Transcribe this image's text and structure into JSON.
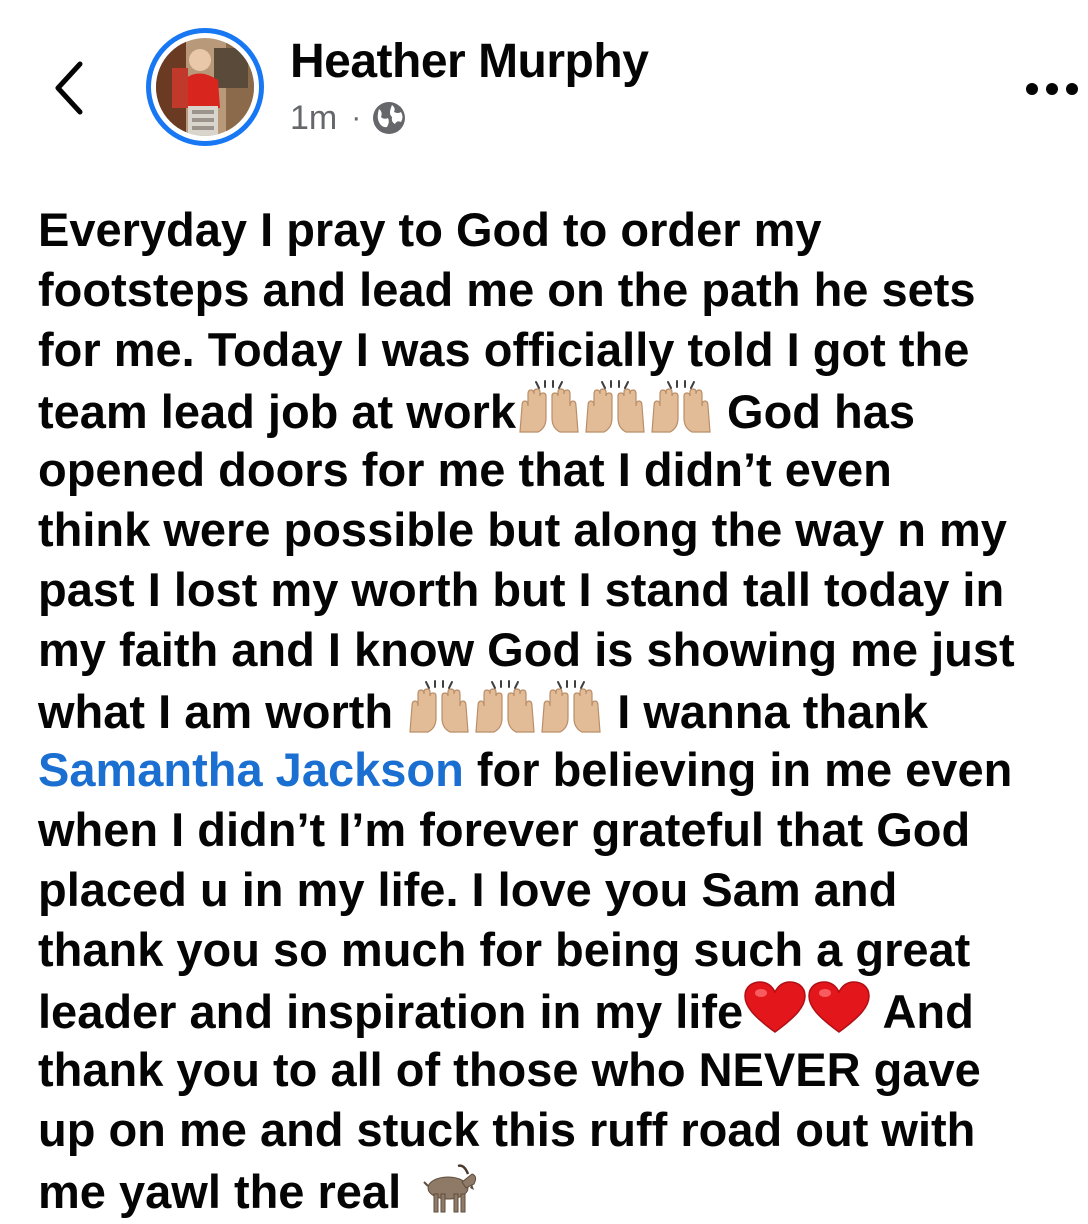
{
  "header": {
    "author_name": "Heather Murphy",
    "timestamp": "1m",
    "separator": "·",
    "privacy_icon": "globe-icon",
    "back_icon": "chevron-left-icon",
    "more_icon": "more-horizontal-icon"
  },
  "post": {
    "lines": [
      [
        {
          "t": "text",
          "v": "Everyday I pray to God to order my"
        }
      ],
      [
        {
          "t": "text",
          "v": "footsteps and lead me on the path he sets"
        }
      ],
      [
        {
          "t": "text",
          "v": "for me. Today I was officially told I got the"
        }
      ],
      [
        {
          "t": "text",
          "v": "team lead job at work"
        },
        {
          "t": "emoji",
          "v": "raising-hands"
        },
        {
          "t": "emoji",
          "v": "raising-hands"
        },
        {
          "t": "emoji",
          "v": "raising-hands"
        },
        {
          "t": "text",
          "v": " God has"
        }
      ],
      [
        {
          "t": "text",
          "v": "opened doors for me that I didn’t even"
        }
      ],
      [
        {
          "t": "text",
          "v": "think were possible but along the way n my"
        }
      ],
      [
        {
          "t": "text",
          "v": "past I lost my worth but I stand tall today in"
        }
      ],
      [
        {
          "t": "text",
          "v": "my faith and I know God is showing me just"
        }
      ],
      [
        {
          "t": "text",
          "v": "what I am worth "
        },
        {
          "t": "emoji",
          "v": "raising-hands"
        },
        {
          "t": "emoji",
          "v": "raising-hands"
        },
        {
          "t": "emoji",
          "v": "raising-hands"
        },
        {
          "t": "text",
          "v": " I wanna thank"
        }
      ],
      [
        {
          "t": "mention",
          "v": "Samantha Jackson"
        },
        {
          "t": "text",
          "v": " for believing in me even"
        }
      ],
      [
        {
          "t": "text",
          "v": "when I didn’t I’m forever grateful that God"
        }
      ],
      [
        {
          "t": "text",
          "v": "placed u in my life. I love you Sam and"
        }
      ],
      [
        {
          "t": "text",
          "v": "thank you so much for being such a great"
        }
      ],
      [
        {
          "t": "text",
          "v": "leader and inspiration in my life"
        },
        {
          "t": "emoji",
          "v": "red-heart"
        },
        {
          "t": "emoji",
          "v": "red-heart"
        },
        {
          "t": "text",
          "v": " And"
        }
      ],
      [
        {
          "t": "text",
          "v": "thank you to all of those who NEVER gave"
        }
      ],
      [
        {
          "t": "text",
          "v": "up on me and stuck this ruff road out with"
        }
      ],
      [
        {
          "t": "text",
          "v": "me yawl the real "
        },
        {
          "t": "emoji",
          "v": "goat"
        }
      ]
    ]
  },
  "colors": {
    "accent": "#1877f2",
    "mention": "#1a6fd1",
    "text": "#050505",
    "secondary": "#65676b"
  }
}
